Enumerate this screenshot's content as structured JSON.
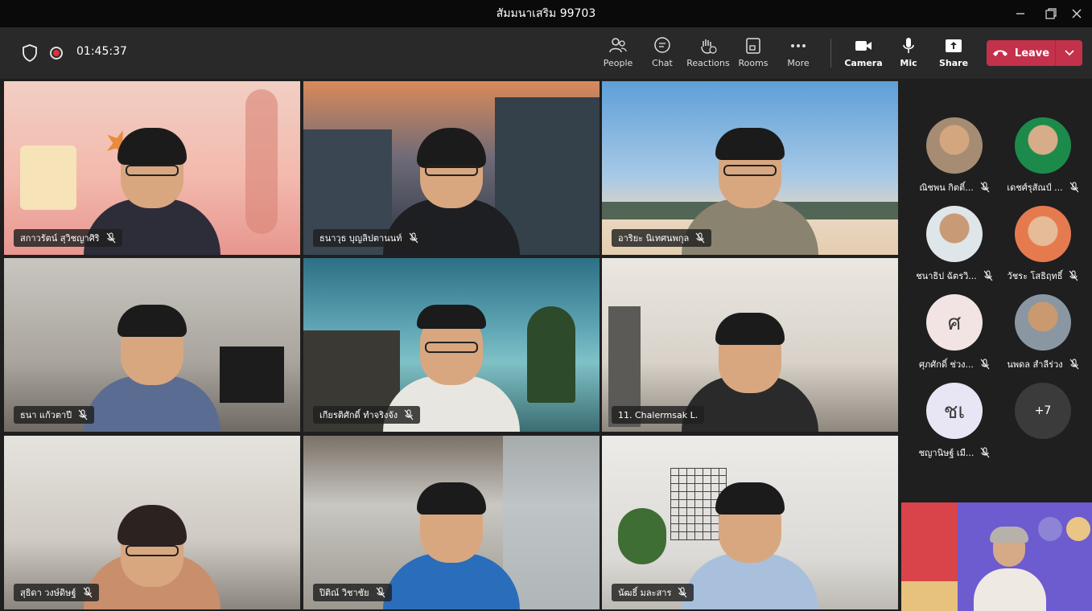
{
  "window": {
    "title": "สัมมนาเสริม 99703"
  },
  "toolbar": {
    "timer": "01:45:37",
    "people_label": "People",
    "chat_label": "Chat",
    "reactions_label": "Reactions",
    "rooms_label": "Rooms",
    "more_label": "More",
    "camera_label": "Camera",
    "mic_label": "Mic",
    "share_label": "Share",
    "leave_label": "Leave"
  },
  "colors": {
    "accent": "#8b8cc7",
    "leave": "#c4314b"
  },
  "tiles": [
    {
      "name": "สกาวรัตน์ สุวิชญาศิริ"
    },
    {
      "name": "ธนาวุธ บุญลิปตานนท์"
    },
    {
      "name": "อาริยะ นิเทศนพกุล"
    },
    {
      "name": "ธนา แก้วตาปี"
    },
    {
      "name": "เกียรติศักดิ์ ทำจริงจัง"
    },
    {
      "name": "11. Chalermsak L."
    },
    {
      "name": "สุธิดา วงษ์ดิษฐ์"
    },
    {
      "name": "ปิติณ์ วิชาชัย"
    },
    {
      "name": "นัฒธิ์ มละสาร"
    }
  ],
  "panel": [
    {
      "name": "ณิชพน กิตติ์...",
      "avatar": "photo"
    },
    {
      "name": "เดชศ์รุสัณป์ ...",
      "avatar": "photo"
    },
    {
      "name": "ชนาธิป ฉัตรวิ...",
      "avatar": "photo"
    },
    {
      "name": "วัชระ โสธิฤทธิ์",
      "avatar": "photo"
    },
    {
      "name": "ศุภศักดิ์ ช่วง...",
      "avatar": "initials",
      "initials": "ศ"
    },
    {
      "name": "นพดล สำลีร่วง",
      "avatar": "photo"
    },
    {
      "name": "ชญานิษฐ์ เมื...",
      "avatar": "initials",
      "initials": "ชเ"
    }
  ],
  "overflow": {
    "label": "+7"
  }
}
